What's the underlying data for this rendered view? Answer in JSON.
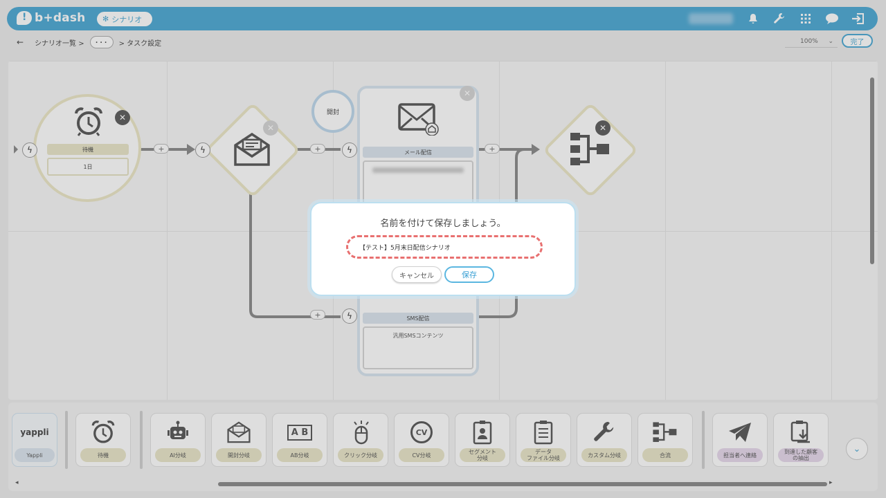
{
  "header": {
    "brand": "b+dash",
    "scenario_pill": "シナリオ",
    "icons": [
      "bell-icon",
      "wrench-icon",
      "grid-icon",
      "chat-icon",
      "logout-icon"
    ]
  },
  "breadcrumb": {
    "back": "←",
    "item1": "シナリオ一覧 >",
    "more": "･･･",
    "item2": "> タスク設定"
  },
  "zoom": {
    "value": "100%",
    "caret": "⌄"
  },
  "done_label": "完了",
  "flow": {
    "wait": {
      "tag": "待機",
      "value": "1日"
    },
    "open_badge": "開封",
    "mail": {
      "tag": "メール配信"
    },
    "sms": {
      "tag": "SMS配信",
      "content": "汎用SMSコンテンツ"
    }
  },
  "palette": {
    "yappli_logo": "yappli",
    "yappli_label": "Yappli",
    "items": [
      {
        "label": "待機"
      },
      {
        "label": "AI分岐"
      },
      {
        "label": "開封分岐"
      },
      {
        "label": "AB分岐"
      },
      {
        "label": "クリック分岐"
      },
      {
        "label": "CV分岐"
      },
      {
        "label": "セグメント\n分岐"
      },
      {
        "label": "データ\nファイル分岐"
      },
      {
        "label": "カスタム分岐"
      },
      {
        "label": "合流"
      },
      {
        "label": "担当者へ連絡"
      },
      {
        "label": "到達した顧客\nの抽出"
      }
    ],
    "ab_icon_text": "A B",
    "cv_icon_text": "CV"
  },
  "modal": {
    "title": "名前を付けて保存しましょう。",
    "input_value": "【テスト】5月末日配信シナリオ",
    "cancel": "キャンセル",
    "save": "保存"
  },
  "colors": {
    "primary": "#4aa8d4",
    "highlight_dashed": "#e87070",
    "tag_yellow": "#e9e6c8",
    "tag_purple": "#e7d8ec"
  }
}
